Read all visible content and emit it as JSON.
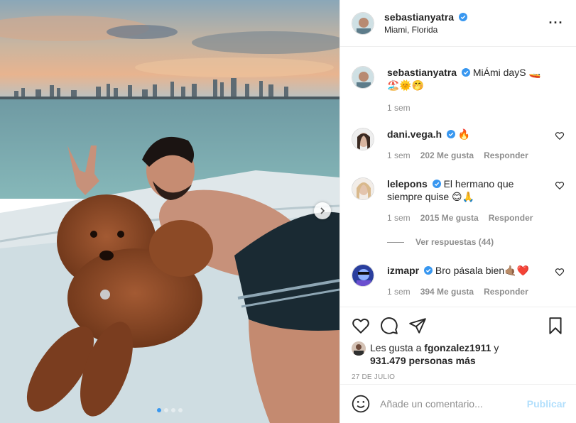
{
  "post": {
    "author": "sebastianyatra",
    "location": "Miami, Florida",
    "more_icon": "more-options-icon",
    "carousel": {
      "slides": 4,
      "active_index": 0
    }
  },
  "caption": {
    "user": "sebastianyatra",
    "text": "MiÁmi dayS 🚤🏖️🌞🤭",
    "time": "1 sem"
  },
  "comments": [
    {
      "user": "dani.vega.h",
      "text": "🔥",
      "time": "1 sem",
      "likes": "202 Me gusta",
      "reply": "Responder"
    },
    {
      "user": "lelepons",
      "text": "El hermano que siempre quise 😊🙏",
      "time": "1 sem",
      "likes": "2015 Me gusta",
      "reply": "Responder"
    },
    {
      "user": "izmapr",
      "text": "Bro pásala bien🤙🏽❤️",
      "time": "1 sem",
      "likes": "394 Me gusta",
      "reply": "Responder"
    }
  ],
  "replies_toggle": "Ver respuestas (44)",
  "likes": {
    "prefix": "Les gusta a",
    "user": "fgonzalez1911",
    "suffix": "y",
    "count": "931.479 personas más"
  },
  "date": "27 DE JULIO",
  "add_comment": {
    "placeholder": "Añade un comentario...",
    "publish": "Publicar"
  },
  "colors": {
    "verified": "#3897f0",
    "link_disabled": "#b2dffc",
    "muted": "#8e8e8e"
  }
}
